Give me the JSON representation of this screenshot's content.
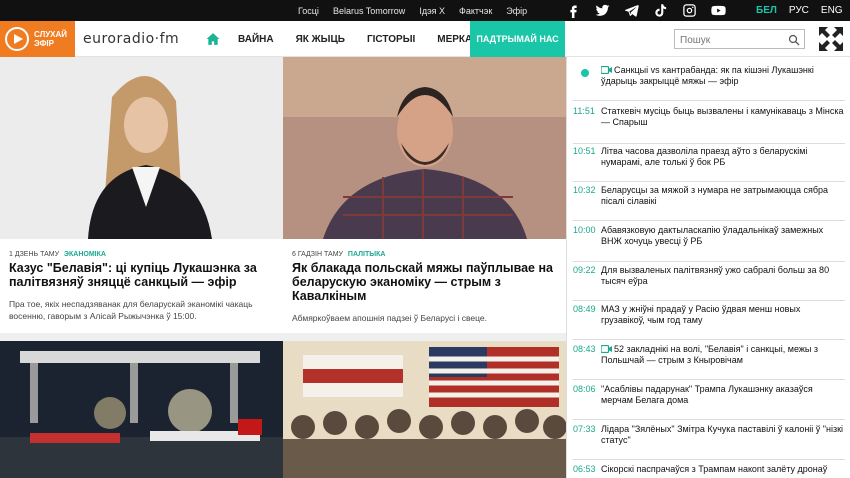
{
  "top_links": [
    "Госці",
    "Belarus Tomorrow",
    "Ідэя Х",
    "Фактчэк",
    "Эфір"
  ],
  "social_icons": [
    "facebook-icon",
    "twitter-icon",
    "telegram-icon",
    "tiktok-icon",
    "instagram-icon",
    "youtube-icon"
  ],
  "langs": [
    "БЕЛ",
    "РУС",
    "ENG"
  ],
  "listen": {
    "line1": "СЛУХАЙ",
    "line2": "ЭФІР"
  },
  "logo": "euroradio·fm",
  "menu": [
    "ВАЙНА",
    "ЯК ЖЫЦЬ",
    "ГІСТОРЫІ",
    "МЕРКАВАННІ"
  ],
  "support_label": "ПАДТРЫМАЙ НАС",
  "search": {
    "placeholder": "Пошук",
    "value": ""
  },
  "colors": {
    "accent": "#1ac6a8",
    "orange": "#f07c22",
    "topbar": "#111111"
  },
  "articles": [
    {
      "time": "1 ДЗЕНЬ ТАМУ",
      "category": "ЭКАНОМІКА",
      "title": "Казус \"Белавія\": ці купіць Лукашэнка за палітвязняў зняццё санкцый — эфір",
      "lead": "Пра тое, якіх неспадзяванак для беларускай эканомікі чакаць восенню, гаворым з Алісай Рыжычэнка ў 15:00."
    },
    {
      "time": "6 ГАДЗІН ТАМУ",
      "category": "ПАЛІТЫКА",
      "title": "Як блакада польскай мяжы паўплывае на беларускую эканоміку — стрым з Кавалкіным",
      "lead": "Абмяркоўваем апошнія падзеі ў Беларусі і свеце."
    }
  ],
  "feed": [
    {
      "time": "",
      "video": true,
      "text": "Санкцыі vs кантрабанда: як па кішэні Лукашэнкі ўдарыць закрыццё мяжы — эфір"
    },
    {
      "time": "11:51",
      "video": false,
      "text": "Статкевіч мусіць быць вызвалены і камунікаваць з Мінска — Спарыш"
    },
    {
      "time": "10:51",
      "video": false,
      "text": "Літва часова дазволіла праезд аўто з беларускімі нумарамі, але толькі ў бок РБ"
    },
    {
      "time": "10:32",
      "video": false,
      "text": "Беларусцы за мяжой з нумара не затрымаюцца сябра пісалі сілавікі"
    },
    {
      "time": "10:00",
      "video": false,
      "text": "Абавязковую дактыласкапію ўладальнікаў замежных ВНЖ хочуць увесці ў РБ"
    },
    {
      "time": "09:22",
      "video": false,
      "text": "Для вызваленых палітвязняў ужо сабралі больш за 80 тысяч еўра"
    },
    {
      "time": "08:49",
      "video": false,
      "text": "МАЗ у жніўні прадаў у Расію ўдвая менш новых грузавікоў, чым год таму"
    },
    {
      "time": "08:43",
      "video": true,
      "text": "52 закладнікі на волі, \"Белавія\" і санкцыі, межы з Польшчай — стрым з Кныровічам"
    },
    {
      "time": "08:06",
      "video": false,
      "text": "\"Асаблівы падарунак\" Трампа Лукашэнку аказаўся мерчам Белага дома"
    },
    {
      "time": "07:33",
      "video": false,
      "text": "Лідара \"Зялёных\" Змітра Кучука паставілі ў калоніі ў \"нізкі статус\""
    },
    {
      "time": "06:53",
      "video": false,
      "text": "Сікорскі паспрачаўся з Трампам накont залёту дронаў"
    }
  ]
}
